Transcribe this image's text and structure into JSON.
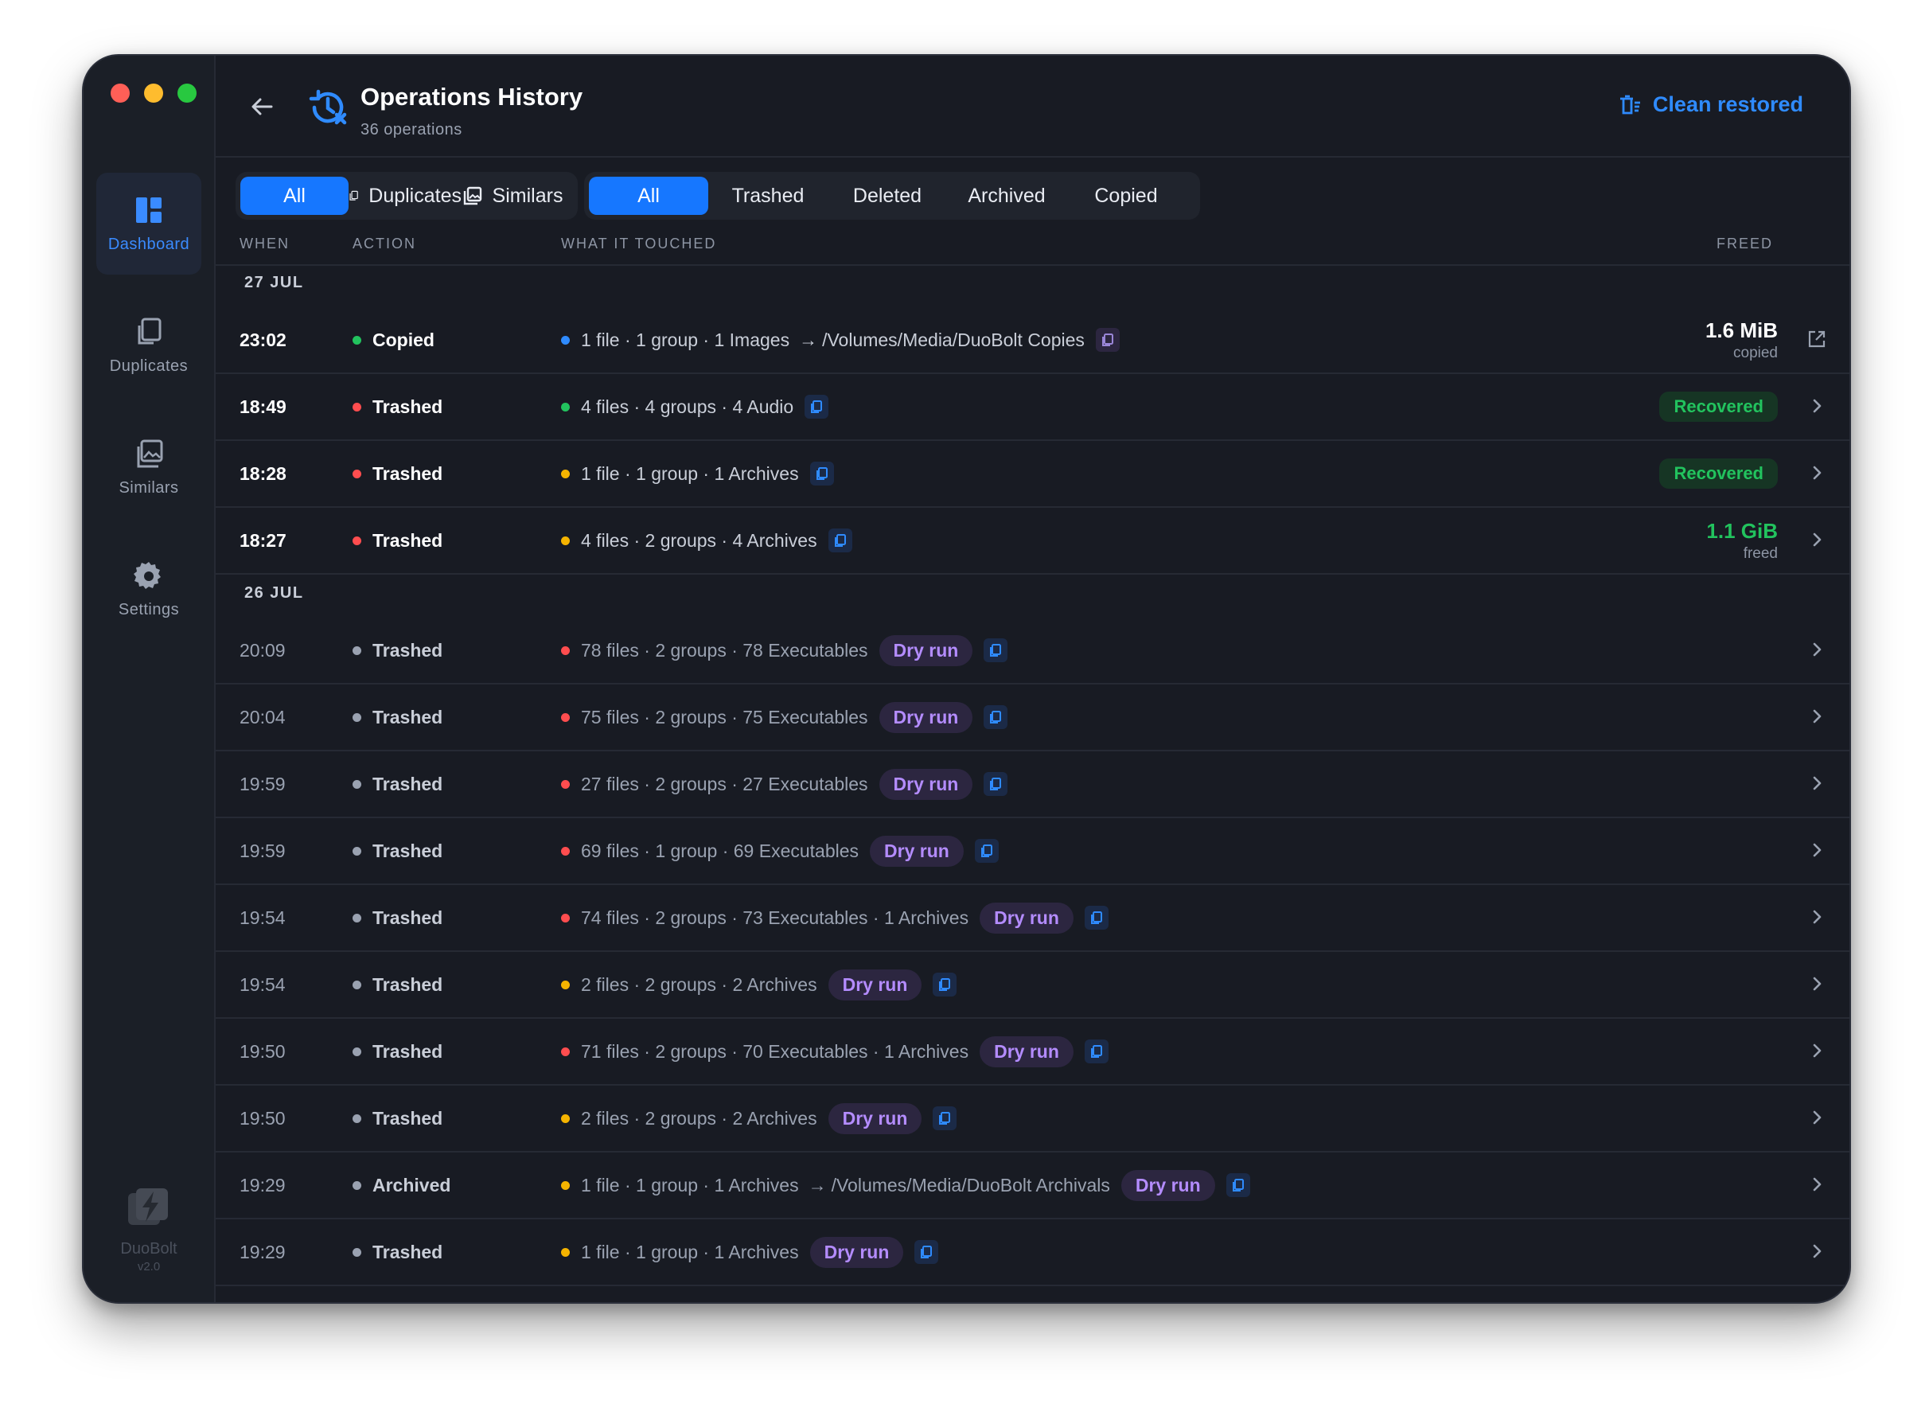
{
  "app": {
    "name": "DuoBolt",
    "version": "v2.0"
  },
  "sidebar": {
    "items": [
      {
        "label": "Dashboard",
        "icon": "dashboard-icon",
        "active": true
      },
      {
        "label": "Duplicates",
        "icon": "duplicates-icon",
        "active": false
      },
      {
        "label": "Similars",
        "icon": "similars-icon",
        "active": false
      },
      {
        "label": "Settings",
        "icon": "gear-icon",
        "active": false
      }
    ]
  },
  "header": {
    "title": "Operations History",
    "subtitle": "36 operations",
    "clean_label": "Clean restored"
  },
  "filters": {
    "kind": [
      "All",
      "Duplicates",
      "Similars"
    ],
    "kind_active": "All",
    "status": [
      "All",
      "Trashed",
      "Deleted",
      "Archived",
      "Copied"
    ],
    "status_active": "All"
  },
  "columns": {
    "when": "WHEN",
    "action": "ACTION",
    "what": "WHAT IT TOUCHED",
    "freed": "FREED"
  },
  "groups": [
    {
      "date": "27 JUL",
      "rows": [
        {
          "when": "23:02",
          "action": "Copied",
          "action_color": "#22c35e",
          "dim": false,
          "dot": "#2f8bff",
          "what": "1 file · 1 group · 1 Images",
          "dest": "/Volumes/Media/DuoBolt Copies",
          "dry": false,
          "copy_style": "purple",
          "freed": "1.6 MiB",
          "freed_sub": "copied",
          "freed_green": false,
          "recovered": false,
          "trail": "external-link-icon"
        },
        {
          "when": "18:49",
          "action": "Trashed",
          "action_color": "#ff4d4f",
          "dim": false,
          "dot": "#22c35e",
          "what": "4 files · 4 groups · 4 Audio",
          "dest": "",
          "dry": false,
          "copy_style": "blue",
          "freed": "",
          "freed_sub": "",
          "freed_green": false,
          "recovered": true,
          "trail": "chevron-right-icon"
        },
        {
          "when": "18:28",
          "action": "Trashed",
          "action_color": "#ff4d4f",
          "dim": false,
          "dot": "#f5b400",
          "what": "1 file · 1 group · 1 Archives",
          "dest": "",
          "dry": false,
          "copy_style": "blue",
          "freed": "",
          "freed_sub": "",
          "freed_green": false,
          "recovered": true,
          "trail": "chevron-right-icon"
        },
        {
          "when": "18:27",
          "action": "Trashed",
          "action_color": "#ff4d4f",
          "dim": false,
          "dot": "#f5b400",
          "what": "4 files · 2 groups · 4 Archives",
          "dest": "",
          "dry": false,
          "copy_style": "blue",
          "freed": "1.1 GiB",
          "freed_sub": "freed",
          "freed_green": true,
          "recovered": false,
          "trail": "chevron-right-icon"
        }
      ]
    },
    {
      "date": "26 JUL",
      "rows": [
        {
          "when": "20:09",
          "action": "Trashed",
          "action_color": "#9aa2b1",
          "dim": true,
          "dot": "#ff4d4f",
          "what": "78 files · 2 groups · 78 Executables",
          "dest": "",
          "dry": true,
          "copy_style": "blue",
          "freed": "",
          "freed_sub": "",
          "freed_green": false,
          "recovered": false,
          "trail": "chevron-right-icon"
        },
        {
          "when": "20:04",
          "action": "Trashed",
          "action_color": "#9aa2b1",
          "dim": true,
          "dot": "#ff4d4f",
          "what": "75 files · 2 groups · 75 Executables",
          "dest": "",
          "dry": true,
          "copy_style": "blue",
          "freed": "",
          "freed_sub": "",
          "freed_green": false,
          "recovered": false,
          "trail": "chevron-right-icon"
        },
        {
          "when": "19:59",
          "action": "Trashed",
          "action_color": "#9aa2b1",
          "dim": true,
          "dot": "#ff4d4f",
          "what": "27 files · 2 groups · 27 Executables",
          "dest": "",
          "dry": true,
          "copy_style": "blue",
          "freed": "",
          "freed_sub": "",
          "freed_green": false,
          "recovered": false,
          "trail": "chevron-right-icon"
        },
        {
          "when": "19:59",
          "action": "Trashed",
          "action_color": "#9aa2b1",
          "dim": true,
          "dot": "#ff4d4f",
          "what": "69 files · 1 group · 69 Executables",
          "dest": "",
          "dry": true,
          "copy_style": "blue",
          "freed": "",
          "freed_sub": "",
          "freed_green": false,
          "recovered": false,
          "trail": "chevron-right-icon"
        },
        {
          "when": "19:54",
          "action": "Trashed",
          "action_color": "#9aa2b1",
          "dim": true,
          "dot": "#ff4d4f",
          "what": "74 files · 2 groups · 73 Executables · 1 Archives",
          "dest": "",
          "dry": true,
          "copy_style": "blue",
          "freed": "",
          "freed_sub": "",
          "freed_green": false,
          "recovered": false,
          "trail": "chevron-right-icon"
        },
        {
          "when": "19:54",
          "action": "Trashed",
          "action_color": "#9aa2b1",
          "dim": true,
          "dot": "#f5b400",
          "what": "2 files · 2 groups · 2 Archives",
          "dest": "",
          "dry": true,
          "copy_style": "blue",
          "freed": "",
          "freed_sub": "",
          "freed_green": false,
          "recovered": false,
          "trail": "chevron-right-icon"
        },
        {
          "when": "19:50",
          "action": "Trashed",
          "action_color": "#9aa2b1",
          "dim": true,
          "dot": "#ff4d4f",
          "what": "71 files · 2 groups · 70 Executables · 1 Archives",
          "dest": "",
          "dry": true,
          "copy_style": "blue",
          "freed": "",
          "freed_sub": "",
          "freed_green": false,
          "recovered": false,
          "trail": "chevron-right-icon"
        },
        {
          "when": "19:50",
          "action": "Trashed",
          "action_color": "#9aa2b1",
          "dim": true,
          "dot": "#f5b400",
          "what": "2 files · 2 groups · 2 Archives",
          "dest": "",
          "dry": true,
          "copy_style": "blue",
          "freed": "",
          "freed_sub": "",
          "freed_green": false,
          "recovered": false,
          "trail": "chevron-right-icon"
        },
        {
          "when": "19:29",
          "action": "Archived",
          "action_color": "#9aa2b1",
          "dim": true,
          "dot": "#f5b400",
          "what": "1 file · 1 group · 1 Archives",
          "dest": "/Volumes/Media/DuoBolt Archivals",
          "dry": true,
          "copy_style": "blue",
          "freed": "",
          "freed_sub": "",
          "freed_green": false,
          "recovered": false,
          "trail": "chevron-right-icon"
        },
        {
          "when": "19:29",
          "action": "Trashed",
          "action_color": "#9aa2b1",
          "dim": true,
          "dot": "#f5b400",
          "what": "1 file · 1 group · 1 Archives",
          "dest": "",
          "dry": true,
          "copy_style": "blue",
          "freed": "",
          "freed_sub": "",
          "freed_green": false,
          "recovered": false,
          "trail": "chevron-right-icon"
        }
      ]
    }
  ],
  "labels": {
    "dry_run": "Dry run",
    "recovered": "Recovered"
  },
  "colors": {
    "accent": "#1677ff",
    "green": "#22c35e",
    "red": "#ff4d4f",
    "amber": "#f5b400",
    "purple": "#b48cff"
  }
}
